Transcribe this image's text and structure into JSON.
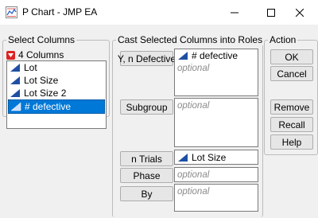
{
  "window": {
    "title": "P Chart - JMP EA",
    "controls": [
      "minimize-icon",
      "maximize-icon",
      "close-icon"
    ]
  },
  "select_columns": {
    "legend": "Select Columns",
    "count_label": "4 Columns",
    "columns": [
      {
        "name": "Lot",
        "icon": "continuous-icon",
        "selected": false
      },
      {
        "name": "Lot Size",
        "icon": "continuous-icon",
        "selected": false
      },
      {
        "name": "Lot Size 2",
        "icon": "continuous-icon",
        "selected": false
      },
      {
        "name": "# defective",
        "icon": "continuous-icon",
        "selected": true
      }
    ]
  },
  "roles": {
    "legend": "Cast Selected Columns into Roles",
    "y": {
      "button": "Y, n Defective",
      "value": "# defective",
      "placeholder": "optional"
    },
    "subgroup": {
      "button": "Subgroup",
      "placeholder": "optional"
    },
    "n_trials": {
      "button": "n Trials",
      "value": "Lot Size"
    },
    "phase": {
      "button": "Phase",
      "placeholder": "optional"
    },
    "by": {
      "button": "By",
      "placeholder": "optional"
    }
  },
  "action": {
    "legend": "Action",
    "ok": "OK",
    "cancel": "Cancel",
    "remove": "Remove",
    "recall": "Recall",
    "help": "Help"
  },
  "colors": {
    "selection": "#0078d7",
    "continuous_icon": "#1f4fa3",
    "menu_triangle": "#dd2222"
  }
}
